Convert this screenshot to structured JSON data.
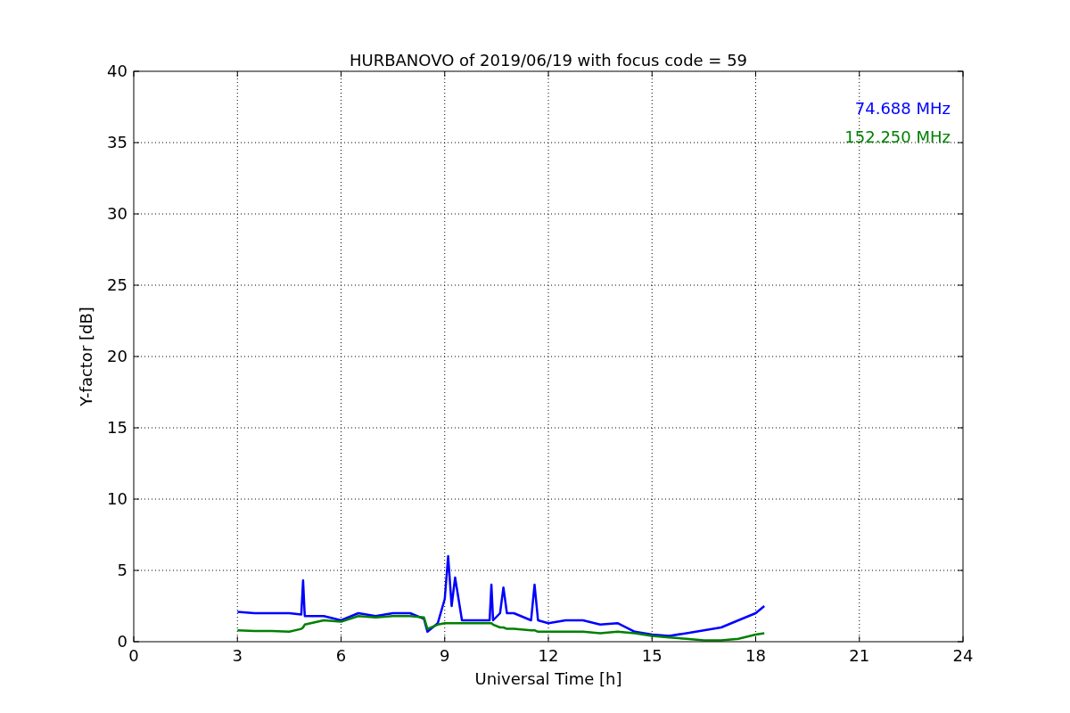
{
  "chart_data": {
    "type": "line",
    "title": "HURBANOVO of 2019/06/19 with focus code = 59",
    "xlabel": "Universal Time [h]",
    "ylabel": "Y-factor [dB]",
    "grid": true,
    "xlim": [
      0,
      24
    ],
    "ylim": [
      0,
      40
    ],
    "xticks": [
      0,
      3,
      6,
      9,
      12,
      15,
      18,
      21,
      24
    ],
    "yticks": [
      0,
      5,
      10,
      15,
      20,
      25,
      30,
      35,
      40
    ],
    "x": [
      3,
      3.5,
      4,
      4.5,
      4.85,
      4.9,
      4.95,
      5.5,
      6,
      6.5,
      7,
      7.5,
      8,
      8.4,
      8.5,
      8.8,
      9,
      9.1,
      9.2,
      9.3,
      9.5,
      10,
      10.3,
      10.35,
      10.4,
      10.6,
      10.7,
      10.8,
      11,
      11.5,
      11.6,
      11.7,
      12,
      12.5,
      13,
      13.5,
      14,
      14.5,
      15,
      15.5,
      16,
      16.5,
      17,
      17.5,
      18,
      18.25
    ],
    "series": [
      {
        "name": "74.688 MHz",
        "color": "#0000ff",
        "values": [
          2.1,
          2.0,
          2.0,
          2.0,
          1.9,
          4.3,
          1.8,
          1.8,
          1.5,
          2.0,
          1.8,
          2.0,
          2.0,
          1.6,
          0.7,
          1.3,
          3.0,
          6.0,
          2.5,
          4.5,
          1.5,
          1.5,
          1.5,
          4.0,
          1.5,
          2.0,
          3.8,
          2.0,
          2.0,
          1.5,
          4.0,
          1.5,
          1.3,
          1.5,
          1.5,
          1.2,
          1.3,
          0.7,
          0.5,
          0.4,
          0.6,
          0.8,
          1.0,
          1.5,
          2.0,
          2.5
        ]
      },
      {
        "name": "152.250 MHz",
        "color": "#008000",
        "values": [
          0.8,
          0.75,
          0.75,
          0.7,
          0.9,
          1.0,
          1.2,
          1.5,
          1.4,
          1.8,
          1.7,
          1.8,
          1.8,
          1.7,
          0.9,
          1.2,
          1.3,
          1.3,
          1.3,
          1.3,
          1.3,
          1.3,
          1.3,
          1.3,
          1.2,
          1.0,
          1.0,
          0.9,
          0.9,
          0.8,
          0.8,
          0.7,
          0.7,
          0.7,
          0.7,
          0.6,
          0.7,
          0.6,
          0.4,
          0.3,
          0.2,
          0.1,
          0.1,
          0.2,
          0.5,
          0.6
        ]
      }
    ]
  }
}
